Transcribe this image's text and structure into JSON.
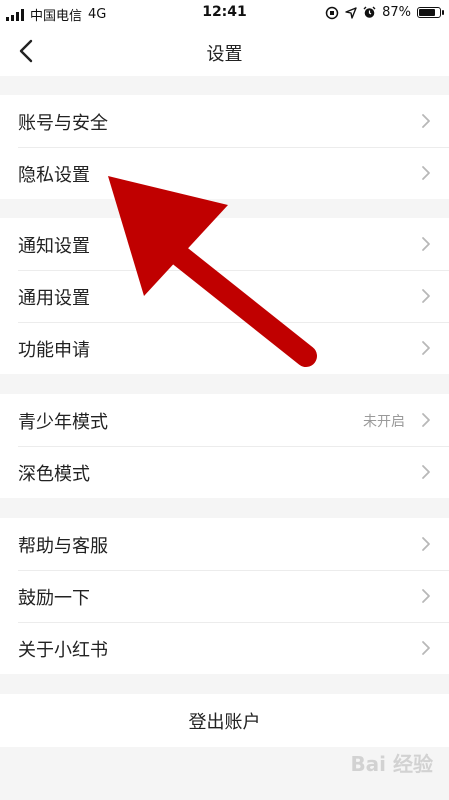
{
  "status_bar": {
    "carrier": "中国电信",
    "network": "4G",
    "time": "12:41",
    "battery_percent": "87%",
    "battery_level": 0.87
  },
  "navbar": {
    "back_icon": "chevron-left-icon",
    "title": "设置"
  },
  "groups": [
    {
      "items": [
        {
          "label": "账号与安全"
        },
        {
          "label": "隐私设置"
        }
      ]
    },
    {
      "items": [
        {
          "label": "通知设置"
        },
        {
          "label": "通用设置"
        },
        {
          "label": "功能申请"
        }
      ]
    },
    {
      "items": [
        {
          "label": "青少年模式",
          "value": "未开启"
        },
        {
          "label": "深色模式"
        }
      ]
    },
    {
      "items": [
        {
          "label": "帮助与客服"
        },
        {
          "label": "鼓励一下"
        },
        {
          "label": "关于小红书"
        }
      ]
    }
  ],
  "logout": {
    "label": "登出账户"
  },
  "annotation": {
    "color": "#c00000",
    "icon": "red-arrow"
  },
  "watermark": {
    "text": "Bai 经验"
  }
}
